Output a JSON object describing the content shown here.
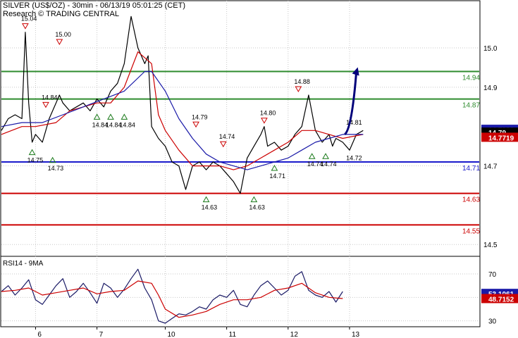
{
  "header": {
    "title": "SILVER (US$/OZ) - 30min - 06/13/19 05:01:25 (CET)",
    "subtitle": "Research © TRADING CENTRAL"
  },
  "chart_data": [
    {
      "type": "line",
      "panel": "price",
      "ylim": [
        14.47,
        15.12
      ],
      "yticks": [
        "15.0",
        "14.9",
        "14.7",
        "14.5"
      ],
      "x_day_labels": [
        "6",
        "7",
        "10",
        "11",
        "12",
        "13"
      ],
      "x_day_positions": [
        5,
        14,
        24,
        33,
        42,
        51
      ],
      "x_range": [
        0,
        70
      ],
      "series": [
        {
          "color": "#000000",
          "x": [
            0,
            1,
            2,
            3,
            3.5,
            4,
            4.5,
            5,
            6,
            6.5,
            7,
            8,
            8.5,
            9,
            10,
            11,
            12,
            13,
            14,
            15,
            16,
            17,
            18,
            19,
            20,
            21,
            21.5,
            22,
            23,
            24,
            25,
            26,
            27,
            28,
            29,
            30,
            31,
            32,
            33,
            34,
            35,
            36,
            37,
            38,
            38.5,
            39,
            40,
            41,
            42,
            43,
            44,
            45,
            46,
            47,
            48,
            48.5,
            49,
            50,
            51,
            52,
            53
          ],
          "values": [
            14.79,
            14.82,
            14.83,
            14.82,
            15.04,
            14.86,
            14.76,
            14.78,
            14.76,
            14.79,
            14.82,
            14.86,
            14.88,
            14.86,
            14.84,
            14.85,
            14.86,
            14.84,
            14.87,
            14.85,
            14.89,
            14.91,
            14.96,
            15.08,
            15.0,
            14.96,
            14.98,
            14.8,
            14.77,
            14.75,
            14.71,
            14.7,
            14.64,
            14.7,
            14.71,
            14.69,
            14.71,
            14.7,
            14.68,
            14.66,
            14.63,
            14.72,
            14.75,
            14.78,
            14.8,
            14.75,
            14.76,
            14.74,
            14.75,
            14.78,
            14.8,
            14.88,
            14.79,
            14.76,
            14.78,
            14.75,
            14.77,
            14.76,
            14.74,
            14.78,
            14.79
          ]
        },
        {
          "color": "#cc0000",
          "x": [
            0,
            3,
            5,
            8,
            10,
            12,
            14,
            16,
            18,
            20,
            22,
            23,
            24,
            26,
            28,
            30,
            32,
            34,
            36,
            38,
            40,
            42,
            44,
            46,
            48,
            50,
            53
          ],
          "values": [
            14.78,
            14.8,
            14.8,
            14.81,
            14.84,
            14.85,
            14.86,
            14.86,
            14.9,
            14.99,
            14.96,
            14.83,
            14.79,
            14.74,
            14.7,
            14.7,
            14.7,
            14.69,
            14.7,
            14.72,
            14.74,
            14.76,
            14.79,
            14.79,
            14.78,
            14.77,
            14.78
          ]
        },
        {
          "color": "#1a1aa8",
          "x": [
            0,
            3,
            6,
            9,
            12,
            15,
            18,
            21,
            22,
            24,
            26,
            28,
            30,
            32,
            34,
            36,
            38,
            40,
            42,
            44,
            46,
            48,
            50,
            53
          ],
          "values": [
            14.8,
            14.81,
            14.81,
            14.83,
            14.85,
            14.87,
            14.89,
            14.94,
            14.94,
            14.89,
            14.82,
            14.77,
            14.73,
            14.71,
            14.7,
            14.69,
            14.7,
            14.71,
            14.72,
            14.74,
            14.76,
            14.77,
            14.78,
            14.78
          ]
        }
      ],
      "levels": [
        {
          "label": "14.94",
          "value": 14.94,
          "color": "#2e8b2e"
        },
        {
          "label": "14.87",
          "value": 14.87,
          "color": "#2e8b2e"
        },
        {
          "label": "14.71",
          "value": 14.71,
          "color": "#1a1acc"
        },
        {
          "label": "14.63",
          "value": 14.63,
          "color": "#cc0000"
        },
        {
          "label": "14.55",
          "value": 14.55,
          "color": "#cc0000"
        }
      ],
      "price_tags": [
        {
          "label": "14.7921",
          "value": 14.7921,
          "bg": "#1a1aa8",
          "fg": "#ffffff"
        },
        {
          "label": "14.79",
          "value": 14.785,
          "bg": "#000000",
          "fg": "#ffffff"
        },
        {
          "label": "14.7719",
          "value": 14.7719,
          "bg": "#cc0000",
          "fg": "#ffffff"
        }
      ],
      "markers": [
        {
          "kind": "down",
          "x": 3.5,
          "value": 15.04,
          "label": "15.04"
        },
        {
          "kind": "down",
          "x": 8.5,
          "value": 15.0,
          "label": "15.00"
        },
        {
          "kind": "down",
          "x": 6.5,
          "value": 14.84,
          "label": "14.84"
        },
        {
          "kind": "down",
          "x": 28.5,
          "value": 14.79,
          "label": "14.79"
        },
        {
          "kind": "down",
          "x": 32.5,
          "value": 14.74,
          "label": "14.74"
        },
        {
          "kind": "down",
          "x": 38.5,
          "value": 14.8,
          "label": "14.80"
        },
        {
          "kind": "down",
          "x": 43.5,
          "value": 14.88,
          "label": "14.88"
        },
        {
          "kind": "up",
          "x": 4.5,
          "value": 14.75,
          "label": "14.75"
        },
        {
          "kind": "up",
          "x": 7.5,
          "value": 14.73,
          "label": "14.73"
        },
        {
          "kind": "up",
          "x": 14,
          "value": 14.84,
          "label": "14.84"
        },
        {
          "kind": "up",
          "x": 16,
          "value": 14.84,
          "label": "14.84"
        },
        {
          "kind": "up",
          "x": 18,
          "value": 14.84,
          "label": "14.84"
        },
        {
          "kind": "up",
          "x": 30,
          "value": 14.63,
          "label": "14.63"
        },
        {
          "kind": "up",
          "x": 37,
          "value": 14.63,
          "label": "14.63"
        },
        {
          "kind": "up",
          "x": 40,
          "value": 14.71,
          "label": "14.71"
        },
        {
          "kind": "up",
          "x": 45.5,
          "value": 14.74,
          "label": "14.74"
        },
        {
          "kind": "up",
          "x": 47.5,
          "value": 14.74,
          "label": "14.74"
        }
      ],
      "annotations": [
        {
          "label": "14.81",
          "x": 50.5,
          "value": 14.81
        },
        {
          "label": "14.72",
          "x": 50.5,
          "value": 14.72
        }
      ],
      "arrow": {
        "from": [
          50.3,
          14.78
        ],
        "to": [
          52,
          14.94
        ],
        "color": "#00007a"
      }
    },
    {
      "type": "line",
      "panel": "rsi",
      "title": "RSI14 - 9MA",
      "ylim": [
        25,
        85
      ],
      "yticks": [
        "70",
        "50",
        "30"
      ],
      "series": [
        {
          "color": "#1a1a66",
          "x": [
            0,
            1,
            2,
            3,
            4,
            5,
            6,
            7,
            8,
            9,
            10,
            11,
            12,
            13,
            14,
            15,
            16,
            17,
            18,
            19,
            20,
            21,
            22,
            23,
            24,
            25,
            26,
            27,
            28,
            29,
            30,
            31,
            32,
            33,
            34,
            35,
            36,
            37,
            38,
            39,
            40,
            41,
            42,
            43,
            44,
            45,
            46,
            47,
            48,
            49,
            50
          ],
          "values": [
            55,
            60,
            52,
            58,
            65,
            48,
            44,
            52,
            60,
            66,
            50,
            55,
            62,
            54,
            45,
            62,
            58,
            50,
            57,
            66,
            74,
            58,
            48,
            30,
            28,
            32,
            36,
            35,
            38,
            42,
            40,
            48,
            52,
            50,
            56,
            44,
            42,
            52,
            60,
            64,
            58,
            52,
            56,
            68,
            72,
            56,
            52,
            50,
            55,
            46,
            55
          ]
        },
        {
          "color": "#cc0000",
          "x": [
            0,
            2,
            4,
            6,
            8,
            10,
            12,
            14,
            16,
            18,
            20,
            22,
            23,
            24,
            26,
            28,
            30,
            32,
            34,
            36,
            38,
            40,
            42,
            44,
            46,
            48,
            50
          ],
          "values": [
            55,
            56,
            58,
            52,
            54,
            56,
            58,
            53,
            55,
            56,
            64,
            62,
            52,
            40,
            33,
            35,
            38,
            44,
            48,
            48,
            50,
            56,
            58,
            62,
            54,
            50,
            49
          ]
        }
      ],
      "price_tags": [
        {
          "label": "53.1061",
          "value": 53.1061,
          "bg": "#1a1aa8",
          "fg": "#ffffff"
        },
        {
          "label": "48.7152",
          "value": 48.7152,
          "bg": "#cc0000",
          "fg": "#ffffff"
        }
      ]
    }
  ]
}
